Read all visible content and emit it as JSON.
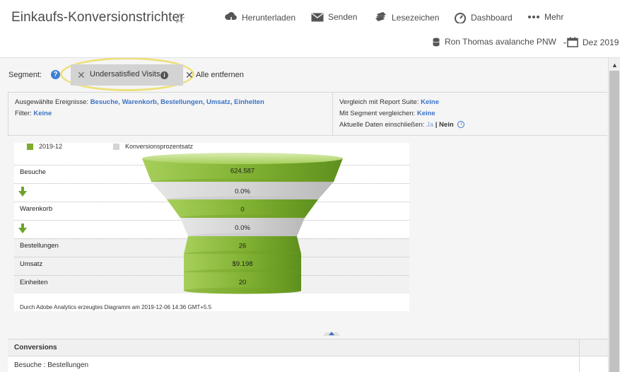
{
  "header": {
    "title": "Einkaufs-Konversionstrichter",
    "toolbar": {
      "download": "Herunterladen",
      "send": "Senden",
      "bookmark": "Lesezeichen",
      "dashboard": "Dashboard",
      "more": "Mehr"
    },
    "report_suite": "Ron Thomas avalanche PNW",
    "date_range": "Dez 2019"
  },
  "segment": {
    "label": "Segment:",
    "chip_label": "Undersatisfied Visits",
    "clear_all": "Alle entfernen"
  },
  "settings": {
    "events_label": "Ausgewählte Ereignisse:",
    "events_value": "Besuche, Warenkorb, Bestellungen, Umsatz, Einheiten",
    "filter_label": "Filter:",
    "filter_value": "Keine",
    "compare_suite_label": "Vergleich mit Report Suite:",
    "compare_suite_value": "Keine",
    "compare_segment_label": "Mit Segment vergleichen:",
    "compare_segment_value": "Keine",
    "current_data_label": "Aktuelle Daten einschließen:",
    "current_data_ja": "Ja",
    "current_data_sep": "|",
    "current_data_nein": "Nein"
  },
  "chart_data": {
    "type": "funnel",
    "legend": [
      {
        "name": "2019-12",
        "color": "#7dab2e"
      },
      {
        "name": "Konversionsprozentsatz",
        "color": "#d4d4d4"
      }
    ],
    "stages": [
      {
        "label": "Besuche",
        "value": "624.587",
        "kind": "metric"
      },
      {
        "label": "",
        "value": "0.0%",
        "kind": "conversion"
      },
      {
        "label": "Warenkorb",
        "value": "0",
        "kind": "metric"
      },
      {
        "label": "",
        "value": "0.0%",
        "kind": "conversion"
      },
      {
        "label": "Bestellungen",
        "value": "26",
        "kind": "metric"
      },
      {
        "label": "Umsatz",
        "value": "$9.198",
        "kind": "metric"
      },
      {
        "label": "Einheiten",
        "value": "20",
        "kind": "metric"
      }
    ],
    "footnote": "Durch Adobe Analytics erzeugtes Diagramm am 2019-12-06 14:36 GMT+5.5"
  },
  "conversions": {
    "header": "Conversions",
    "row": "Besuche : Bestellungen"
  },
  "colors": {
    "green": "#7dab2e",
    "gray": "#d4d4d4",
    "link_blue": "#3b73c4",
    "highlight": "#ede07a"
  }
}
